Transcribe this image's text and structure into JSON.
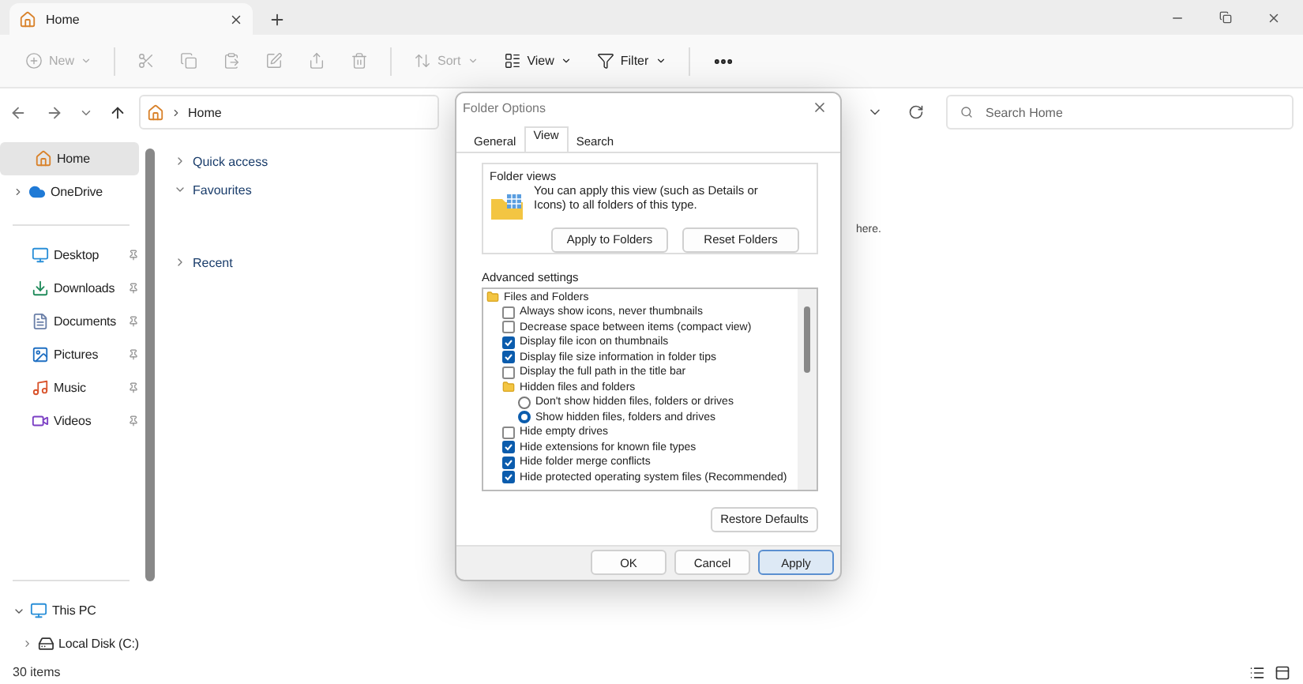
{
  "tab": {
    "title": "Home"
  },
  "toolbar": [
    {
      "kind": "labeled",
      "label": "New",
      "disabled": true
    },
    {
      "kind": "icon",
      "disabled": true
    },
    {
      "kind": "icon",
      "disabled": true
    },
    {
      "kind": "icon",
      "disabled": true
    },
    {
      "kind": "icon",
      "disabled": true
    },
    {
      "kind": "icon",
      "disabled": true
    },
    {
      "kind": "icon",
      "disabled": true
    },
    {
      "kind": "labeled",
      "label": "Sort",
      "disabled": true
    },
    {
      "kind": "labeled",
      "label": "View",
      "disabled": false
    },
    {
      "kind": "labeled",
      "label": "Filter",
      "disabled": false
    },
    {
      "kind": "more",
      "disabled": false
    }
  ],
  "address": {
    "crumb": "Home"
  },
  "search": {
    "placeholder": "Search Home"
  },
  "sidebar": {
    "top": [
      {
        "label": "Home",
        "selected": true
      },
      {
        "label": "OneDrive",
        "selected": false,
        "expanded": false
      }
    ],
    "quick": [
      {
        "label": "Desktop",
        "pinned": true
      },
      {
        "label": "Downloads",
        "pinned": true
      },
      {
        "label": "Documents",
        "pinned": true
      },
      {
        "label": "Pictures",
        "pinned": true
      },
      {
        "label": "Music",
        "pinned": true
      },
      {
        "label": "Videos",
        "pinned": true
      }
    ],
    "drives": [
      {
        "label": "This PC",
        "expanded": true,
        "children": [
          {
            "label": "Local Disk (C:)",
            "expanded": false
          }
        ]
      }
    ]
  },
  "sections": [
    {
      "label": "Quick access",
      "expanded": false
    },
    {
      "label": "Favourites",
      "expanded": true
    },
    {
      "label": "Recent",
      "expanded": false
    }
  ],
  "hint": "here.",
  "status_bar": {
    "count": "30 items"
  },
  "dialog": {
    "title": "Folder Options",
    "tabs": [
      {
        "label": "General",
        "selected": false
      },
      {
        "label": "View",
        "selected": true
      },
      {
        "label": "Search",
        "selected": false
      }
    ],
    "folder_views": {
      "title": "Folder views",
      "description": "You can apply this view (such as Details or Icons) to all folders of this type.",
      "buttons": [
        "Apply to Folders",
        "Reset Folders"
      ]
    },
    "advanced": {
      "label": "Advanced settings",
      "tree": [
        {
          "kind": "folder",
          "label": "Files and Folders",
          "children": [
            {
              "kind": "checkbox",
              "label": "Always show icons, never thumbnails",
              "checked": false
            },
            {
              "kind": "checkbox",
              "label": "Decrease space between items (compact view)",
              "checked": false
            },
            {
              "kind": "checkbox",
              "label": "Display file icon on thumbnails",
              "checked": true
            },
            {
              "kind": "checkbox",
              "label": "Display file size information in folder tips",
              "checked": true
            },
            {
              "kind": "checkbox",
              "label": "Display the full path in the title bar",
              "checked": false
            },
            {
              "kind": "folder",
              "label": "Hidden files and folders",
              "children": [
                {
                  "kind": "radio",
                  "label": "Don't show hidden files, folders or drives",
                  "checked": false
                },
                {
                  "kind": "radio",
                  "label": "Show hidden files, folders and drives",
                  "checked": true
                }
              ]
            },
            {
              "kind": "checkbox",
              "label": "Hide empty drives",
              "checked": false
            },
            {
              "kind": "checkbox",
              "label": "Hide extensions for known file types",
              "checked": true
            },
            {
              "kind": "checkbox",
              "label": "Hide folder merge conflicts",
              "checked": true
            },
            {
              "kind": "checkbox",
              "label": "Hide protected operating system files (Recommended)",
              "checked": true
            }
          ]
        }
      ]
    },
    "restore": "Restore Defaults",
    "footer": [
      {
        "label": "OK",
        "default": false
      },
      {
        "label": "Cancel",
        "default": false
      },
      {
        "label": "Apply",
        "default": true
      }
    ]
  }
}
